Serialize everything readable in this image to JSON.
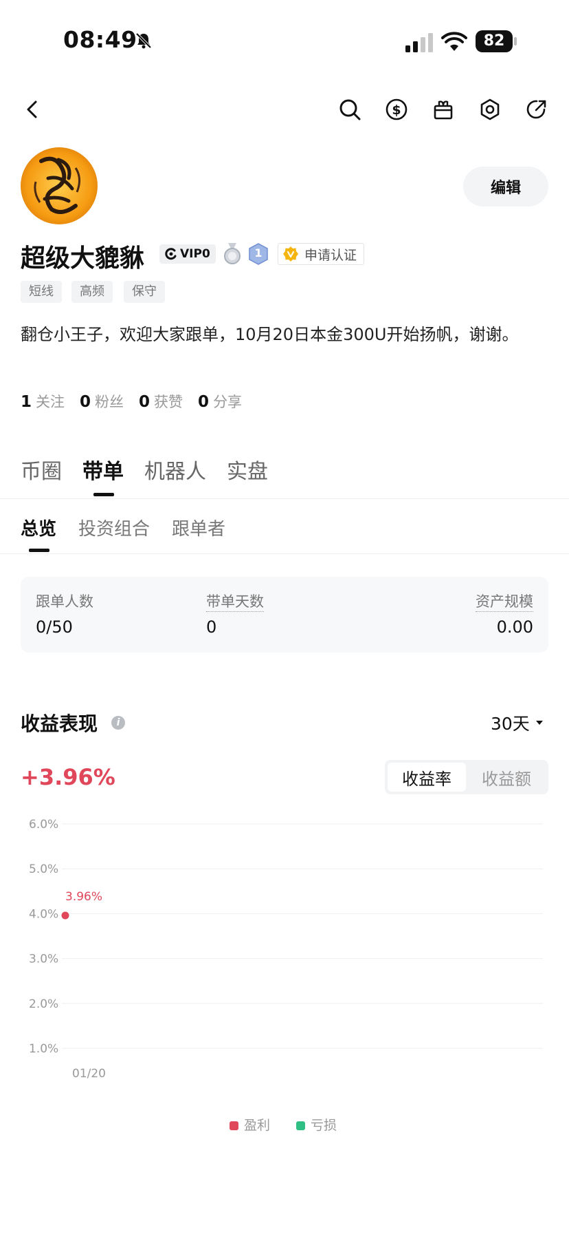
{
  "status_bar": {
    "time": "08:49",
    "battery": "82"
  },
  "profile": {
    "username": "超级大貔貅",
    "vip_label": "VIP0",
    "level_badge": "1",
    "verify_label": "申请认证",
    "edit_label": "编辑",
    "tags": [
      "短线",
      "高频",
      "保守"
    ],
    "bio": "翻仓小王子，欢迎大家跟单，10月20日本金300U开始扬帆，谢谢。",
    "stats": [
      {
        "num": "1",
        "label": "关注"
      },
      {
        "num": "0",
        "label": "粉丝"
      },
      {
        "num": "0",
        "label": "获赞"
      },
      {
        "num": "0",
        "label": "分享"
      }
    ]
  },
  "tabs": [
    "币圈",
    "带单",
    "机器人",
    "实盘"
  ],
  "subtabs": [
    "总览",
    "投资组合",
    "跟单者"
  ],
  "overview": {
    "followers_label": "跟单人数",
    "followers_value": "0/50",
    "days_label": "带单天数",
    "days_value": "0",
    "assets_label": "资产规模",
    "assets_value": "0.00"
  },
  "performance": {
    "title": "收益表现",
    "period": "30天",
    "return_pct": "+3.96%",
    "seg_rate": "收益率",
    "seg_amount": "收益额",
    "legend_profit": "盈利",
    "legend_loss": "亏损"
  },
  "colors": {
    "profit": "#e0475a",
    "loss": "#2fbf85"
  },
  "chart_data": {
    "type": "scatter",
    "y_ticks": [
      "6.0%",
      "5.0%",
      "4.0%",
      "3.0%",
      "2.0%",
      "1.0%"
    ],
    "ylim": [
      1.0,
      6.0
    ],
    "x_ticks": [
      "01/20"
    ],
    "points": [
      {
        "x": "01/20",
        "y": 3.96,
        "label": "3.96%"
      }
    ]
  }
}
